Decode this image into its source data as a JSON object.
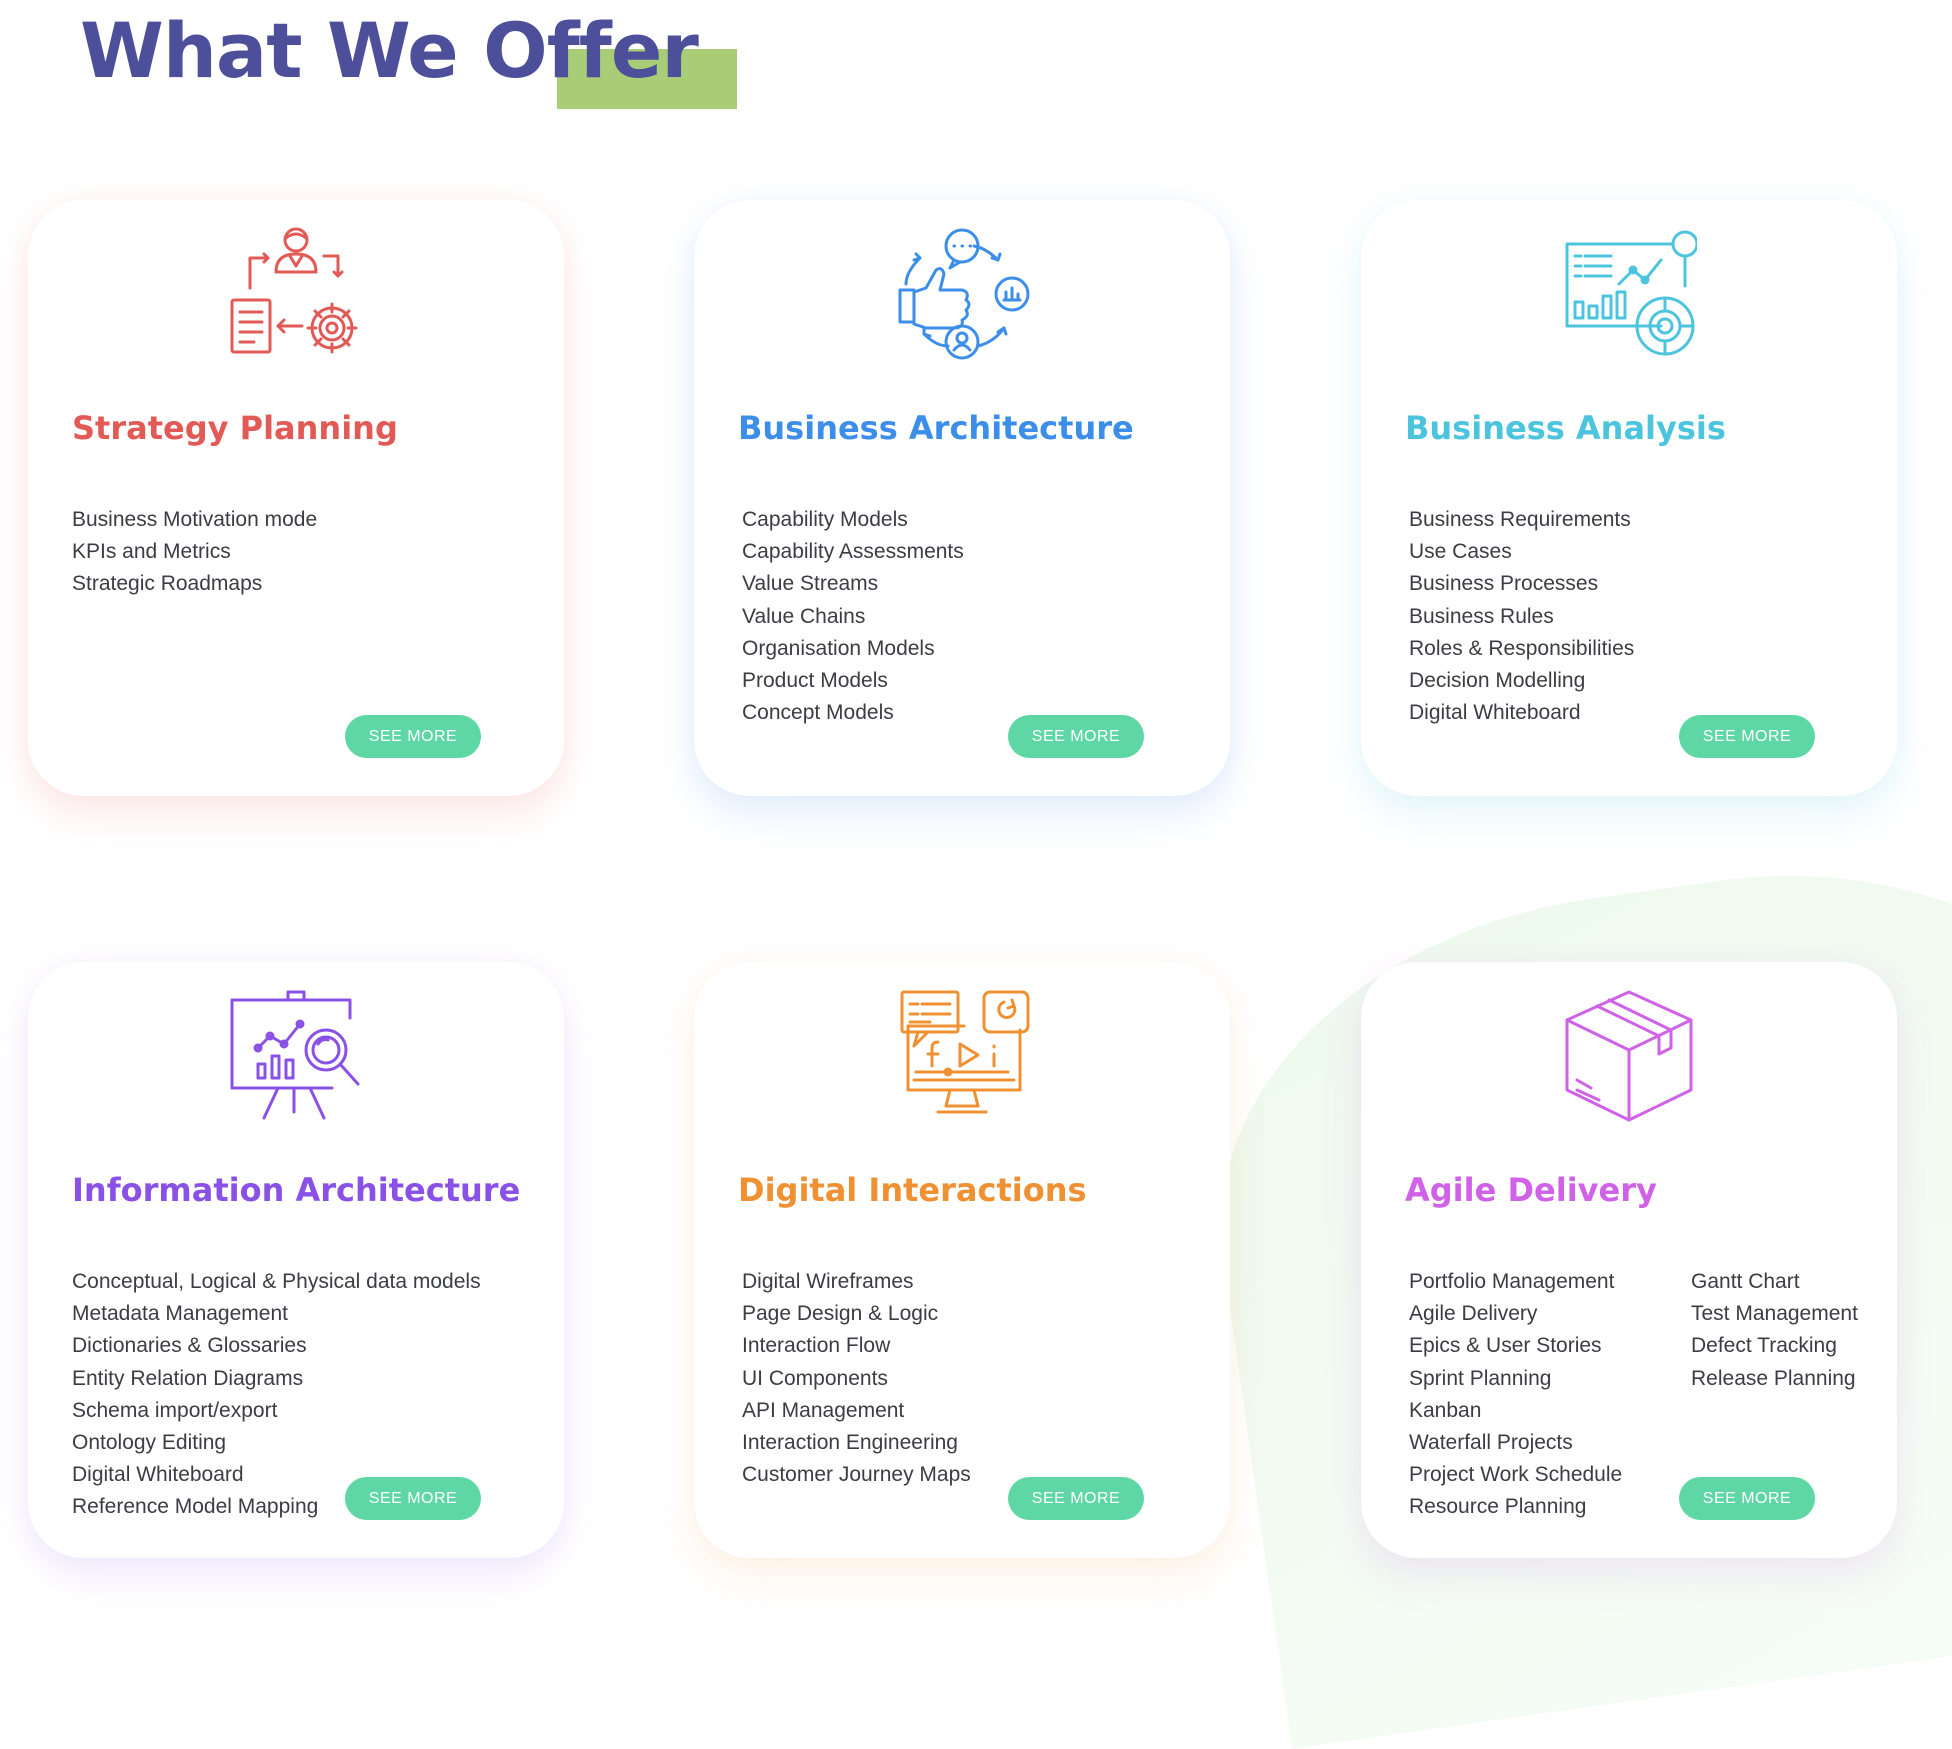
{
  "header": {
    "title": "What We Offer",
    "highlight_color": "#a9cd76",
    "title_color": "#4e4f9a"
  },
  "button_color": "#5fd7a5",
  "cards": [
    {
      "title": "Strategy Planning",
      "color": "#e25a55",
      "icon": "strategy-planning-icon",
      "button": "SEE MORE",
      "items": [
        "Business Motivation mode",
        "KPIs and Metrics",
        "Strategic Roadmaps"
      ]
    },
    {
      "title": "Business Architecture",
      "color": "#3c8ee8",
      "icon": "business-architecture-icon",
      "button": "SEE MORE",
      "items": [
        "Capability Models",
        "Capability Assessments",
        "Value Streams",
        "Value Chains",
        "Organisation Models",
        "Product Models",
        "Concept Models"
      ]
    },
    {
      "title": "Business Analysis",
      "color": "#4cc4de",
      "icon": "business-analysis-icon",
      "button": "SEE MORE",
      "items": [
        "Business Requirements",
        "Use Cases",
        "Business Processes",
        "Business Rules",
        "Roles & Responsibilities",
        "Decision Modelling",
        "Digital Whiteboard"
      ]
    },
    {
      "title": "Information Architecture",
      "color": "#8a51e6",
      "icon": "information-architecture-icon",
      "button": "SEE MORE",
      "items": [
        "Conceptual, Logical & Physical data models",
        "Metadata Management",
        "Dictionaries & Glossaries",
        "Entity Relation Diagrams",
        "Schema import/export",
        "Ontology Editing",
        "Digital Whiteboard",
        "Reference Model Mapping"
      ]
    },
    {
      "title": "Digital Interactions",
      "color": "#ef9133",
      "icon": "digital-interactions-icon",
      "button": "SEE MORE",
      "items": [
        "Digital Wireframes",
        "Page Design & Logic",
        "Interaction Flow",
        "UI Components",
        "API Management",
        "Interaction Engineering",
        "Customer Journey Maps"
      ]
    },
    {
      "title": "Agile Delivery",
      "color": "#cf62e6",
      "icon": "agile-delivery-icon",
      "button": "SEE MORE",
      "items": [
        "Portfolio Management",
        "Agile Delivery",
        "Epics & User Stories",
        "Sprint Planning",
        "Kanban",
        "Waterfall Projects",
        "Project Work Schedule",
        "Resource Planning"
      ],
      "items_col2": [
        "Gantt Chart",
        "Test Management",
        "Defect Tracking",
        "Release Planning"
      ]
    }
  ]
}
